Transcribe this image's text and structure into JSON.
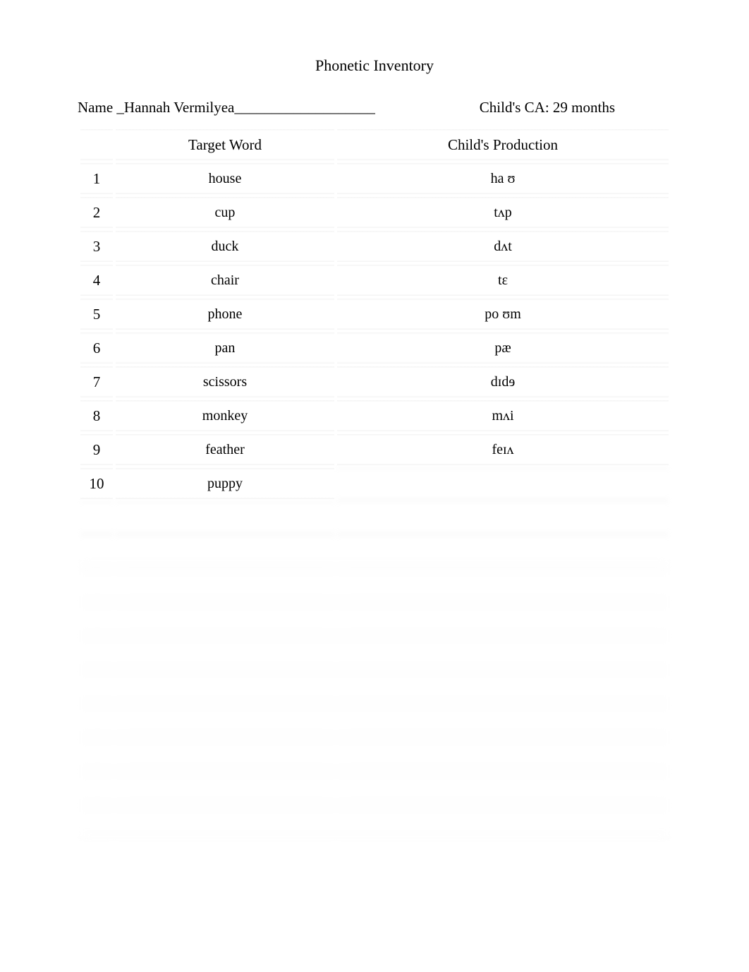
{
  "title": "Phonetic Inventory",
  "header": {
    "name_label": "Name _",
    "name_value": "Hannah Vermilyea",
    "name_underline": "___________________",
    "ca_label": "Child's CA: ",
    "ca_value": "29 months"
  },
  "columns": {
    "num": "",
    "target": "Target Word",
    "production": "Child's Production"
  },
  "rows": [
    {
      "num": "1",
      "target": "house",
      "production": "ha ʊ"
    },
    {
      "num": "2",
      "target": "cup",
      "production": "tʌp"
    },
    {
      "num": "3",
      "target": "duck",
      "production": "dʌt"
    },
    {
      "num": "4",
      "target": "chair",
      "production": "tɛ"
    },
    {
      "num": "5",
      "target": "phone",
      "production": "po ʊm"
    },
    {
      "num": "6",
      "target": "pan",
      "production": "pæ"
    },
    {
      "num": "7",
      "target": "scissors",
      "production": "dɪdɘ"
    },
    {
      "num": "8",
      "target": "monkey",
      "production": "mʌi"
    },
    {
      "num": "9",
      "target": "feather",
      "production": "feɪʌ"
    },
    {
      "num": "10",
      "target": "puppy",
      "production": ""
    },
    {
      "num": "",
      "target": "",
      "production": ""
    },
    {
      "num": "",
      "target": "",
      "production": ""
    },
    {
      "num": "",
      "target": "",
      "production": ""
    },
    {
      "num": "",
      "target": "",
      "production": ""
    },
    {
      "num": "",
      "target": "",
      "production": ""
    },
    {
      "num": "",
      "target": "",
      "production": ""
    },
    {
      "num": "",
      "target": "",
      "production": ""
    },
    {
      "num": "",
      "target": "",
      "production": ""
    },
    {
      "num": "",
      "target": "",
      "production": ""
    },
    {
      "num": "",
      "target": "",
      "production": ""
    }
  ]
}
